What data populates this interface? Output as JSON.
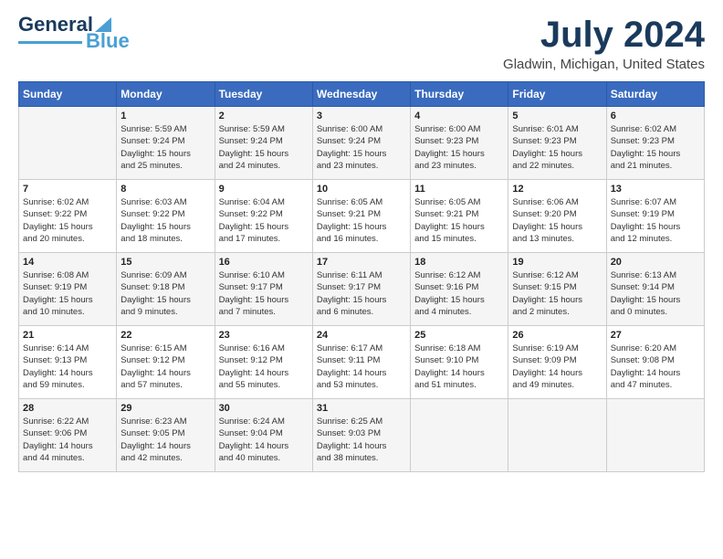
{
  "header": {
    "logo_text1": "General",
    "logo_text2": "Blue",
    "month": "July 2024",
    "location": "Gladwin, Michigan, United States"
  },
  "weekdays": [
    "Sunday",
    "Monday",
    "Tuesday",
    "Wednesday",
    "Thursday",
    "Friday",
    "Saturday"
  ],
  "weeks": [
    [
      {
        "day": "",
        "info": ""
      },
      {
        "day": "1",
        "info": "Sunrise: 5:59 AM\nSunset: 9:24 PM\nDaylight: 15 hours\nand 25 minutes."
      },
      {
        "day": "2",
        "info": "Sunrise: 5:59 AM\nSunset: 9:24 PM\nDaylight: 15 hours\nand 24 minutes."
      },
      {
        "day": "3",
        "info": "Sunrise: 6:00 AM\nSunset: 9:24 PM\nDaylight: 15 hours\nand 23 minutes."
      },
      {
        "day": "4",
        "info": "Sunrise: 6:00 AM\nSunset: 9:23 PM\nDaylight: 15 hours\nand 23 minutes."
      },
      {
        "day": "5",
        "info": "Sunrise: 6:01 AM\nSunset: 9:23 PM\nDaylight: 15 hours\nand 22 minutes."
      },
      {
        "day": "6",
        "info": "Sunrise: 6:02 AM\nSunset: 9:23 PM\nDaylight: 15 hours\nand 21 minutes."
      }
    ],
    [
      {
        "day": "7",
        "info": "Sunrise: 6:02 AM\nSunset: 9:22 PM\nDaylight: 15 hours\nand 20 minutes."
      },
      {
        "day": "8",
        "info": "Sunrise: 6:03 AM\nSunset: 9:22 PM\nDaylight: 15 hours\nand 18 minutes."
      },
      {
        "day": "9",
        "info": "Sunrise: 6:04 AM\nSunset: 9:22 PM\nDaylight: 15 hours\nand 17 minutes."
      },
      {
        "day": "10",
        "info": "Sunrise: 6:05 AM\nSunset: 9:21 PM\nDaylight: 15 hours\nand 16 minutes."
      },
      {
        "day": "11",
        "info": "Sunrise: 6:05 AM\nSunset: 9:21 PM\nDaylight: 15 hours\nand 15 minutes."
      },
      {
        "day": "12",
        "info": "Sunrise: 6:06 AM\nSunset: 9:20 PM\nDaylight: 15 hours\nand 13 minutes."
      },
      {
        "day": "13",
        "info": "Sunrise: 6:07 AM\nSunset: 9:19 PM\nDaylight: 15 hours\nand 12 minutes."
      }
    ],
    [
      {
        "day": "14",
        "info": "Sunrise: 6:08 AM\nSunset: 9:19 PM\nDaylight: 15 hours\nand 10 minutes."
      },
      {
        "day": "15",
        "info": "Sunrise: 6:09 AM\nSunset: 9:18 PM\nDaylight: 15 hours\nand 9 minutes."
      },
      {
        "day": "16",
        "info": "Sunrise: 6:10 AM\nSunset: 9:17 PM\nDaylight: 15 hours\nand 7 minutes."
      },
      {
        "day": "17",
        "info": "Sunrise: 6:11 AM\nSunset: 9:17 PM\nDaylight: 15 hours\nand 6 minutes."
      },
      {
        "day": "18",
        "info": "Sunrise: 6:12 AM\nSunset: 9:16 PM\nDaylight: 15 hours\nand 4 minutes."
      },
      {
        "day": "19",
        "info": "Sunrise: 6:12 AM\nSunset: 9:15 PM\nDaylight: 15 hours\nand 2 minutes."
      },
      {
        "day": "20",
        "info": "Sunrise: 6:13 AM\nSunset: 9:14 PM\nDaylight: 15 hours\nand 0 minutes."
      }
    ],
    [
      {
        "day": "21",
        "info": "Sunrise: 6:14 AM\nSunset: 9:13 PM\nDaylight: 14 hours\nand 59 minutes."
      },
      {
        "day": "22",
        "info": "Sunrise: 6:15 AM\nSunset: 9:12 PM\nDaylight: 14 hours\nand 57 minutes."
      },
      {
        "day": "23",
        "info": "Sunrise: 6:16 AM\nSunset: 9:12 PM\nDaylight: 14 hours\nand 55 minutes."
      },
      {
        "day": "24",
        "info": "Sunrise: 6:17 AM\nSunset: 9:11 PM\nDaylight: 14 hours\nand 53 minutes."
      },
      {
        "day": "25",
        "info": "Sunrise: 6:18 AM\nSunset: 9:10 PM\nDaylight: 14 hours\nand 51 minutes."
      },
      {
        "day": "26",
        "info": "Sunrise: 6:19 AM\nSunset: 9:09 PM\nDaylight: 14 hours\nand 49 minutes."
      },
      {
        "day": "27",
        "info": "Sunrise: 6:20 AM\nSunset: 9:08 PM\nDaylight: 14 hours\nand 47 minutes."
      }
    ],
    [
      {
        "day": "28",
        "info": "Sunrise: 6:22 AM\nSunset: 9:06 PM\nDaylight: 14 hours\nand 44 minutes."
      },
      {
        "day": "29",
        "info": "Sunrise: 6:23 AM\nSunset: 9:05 PM\nDaylight: 14 hours\nand 42 minutes."
      },
      {
        "day": "30",
        "info": "Sunrise: 6:24 AM\nSunset: 9:04 PM\nDaylight: 14 hours\nand 40 minutes."
      },
      {
        "day": "31",
        "info": "Sunrise: 6:25 AM\nSunset: 9:03 PM\nDaylight: 14 hours\nand 38 minutes."
      },
      {
        "day": "",
        "info": ""
      },
      {
        "day": "",
        "info": ""
      },
      {
        "day": "",
        "info": ""
      }
    ]
  ]
}
